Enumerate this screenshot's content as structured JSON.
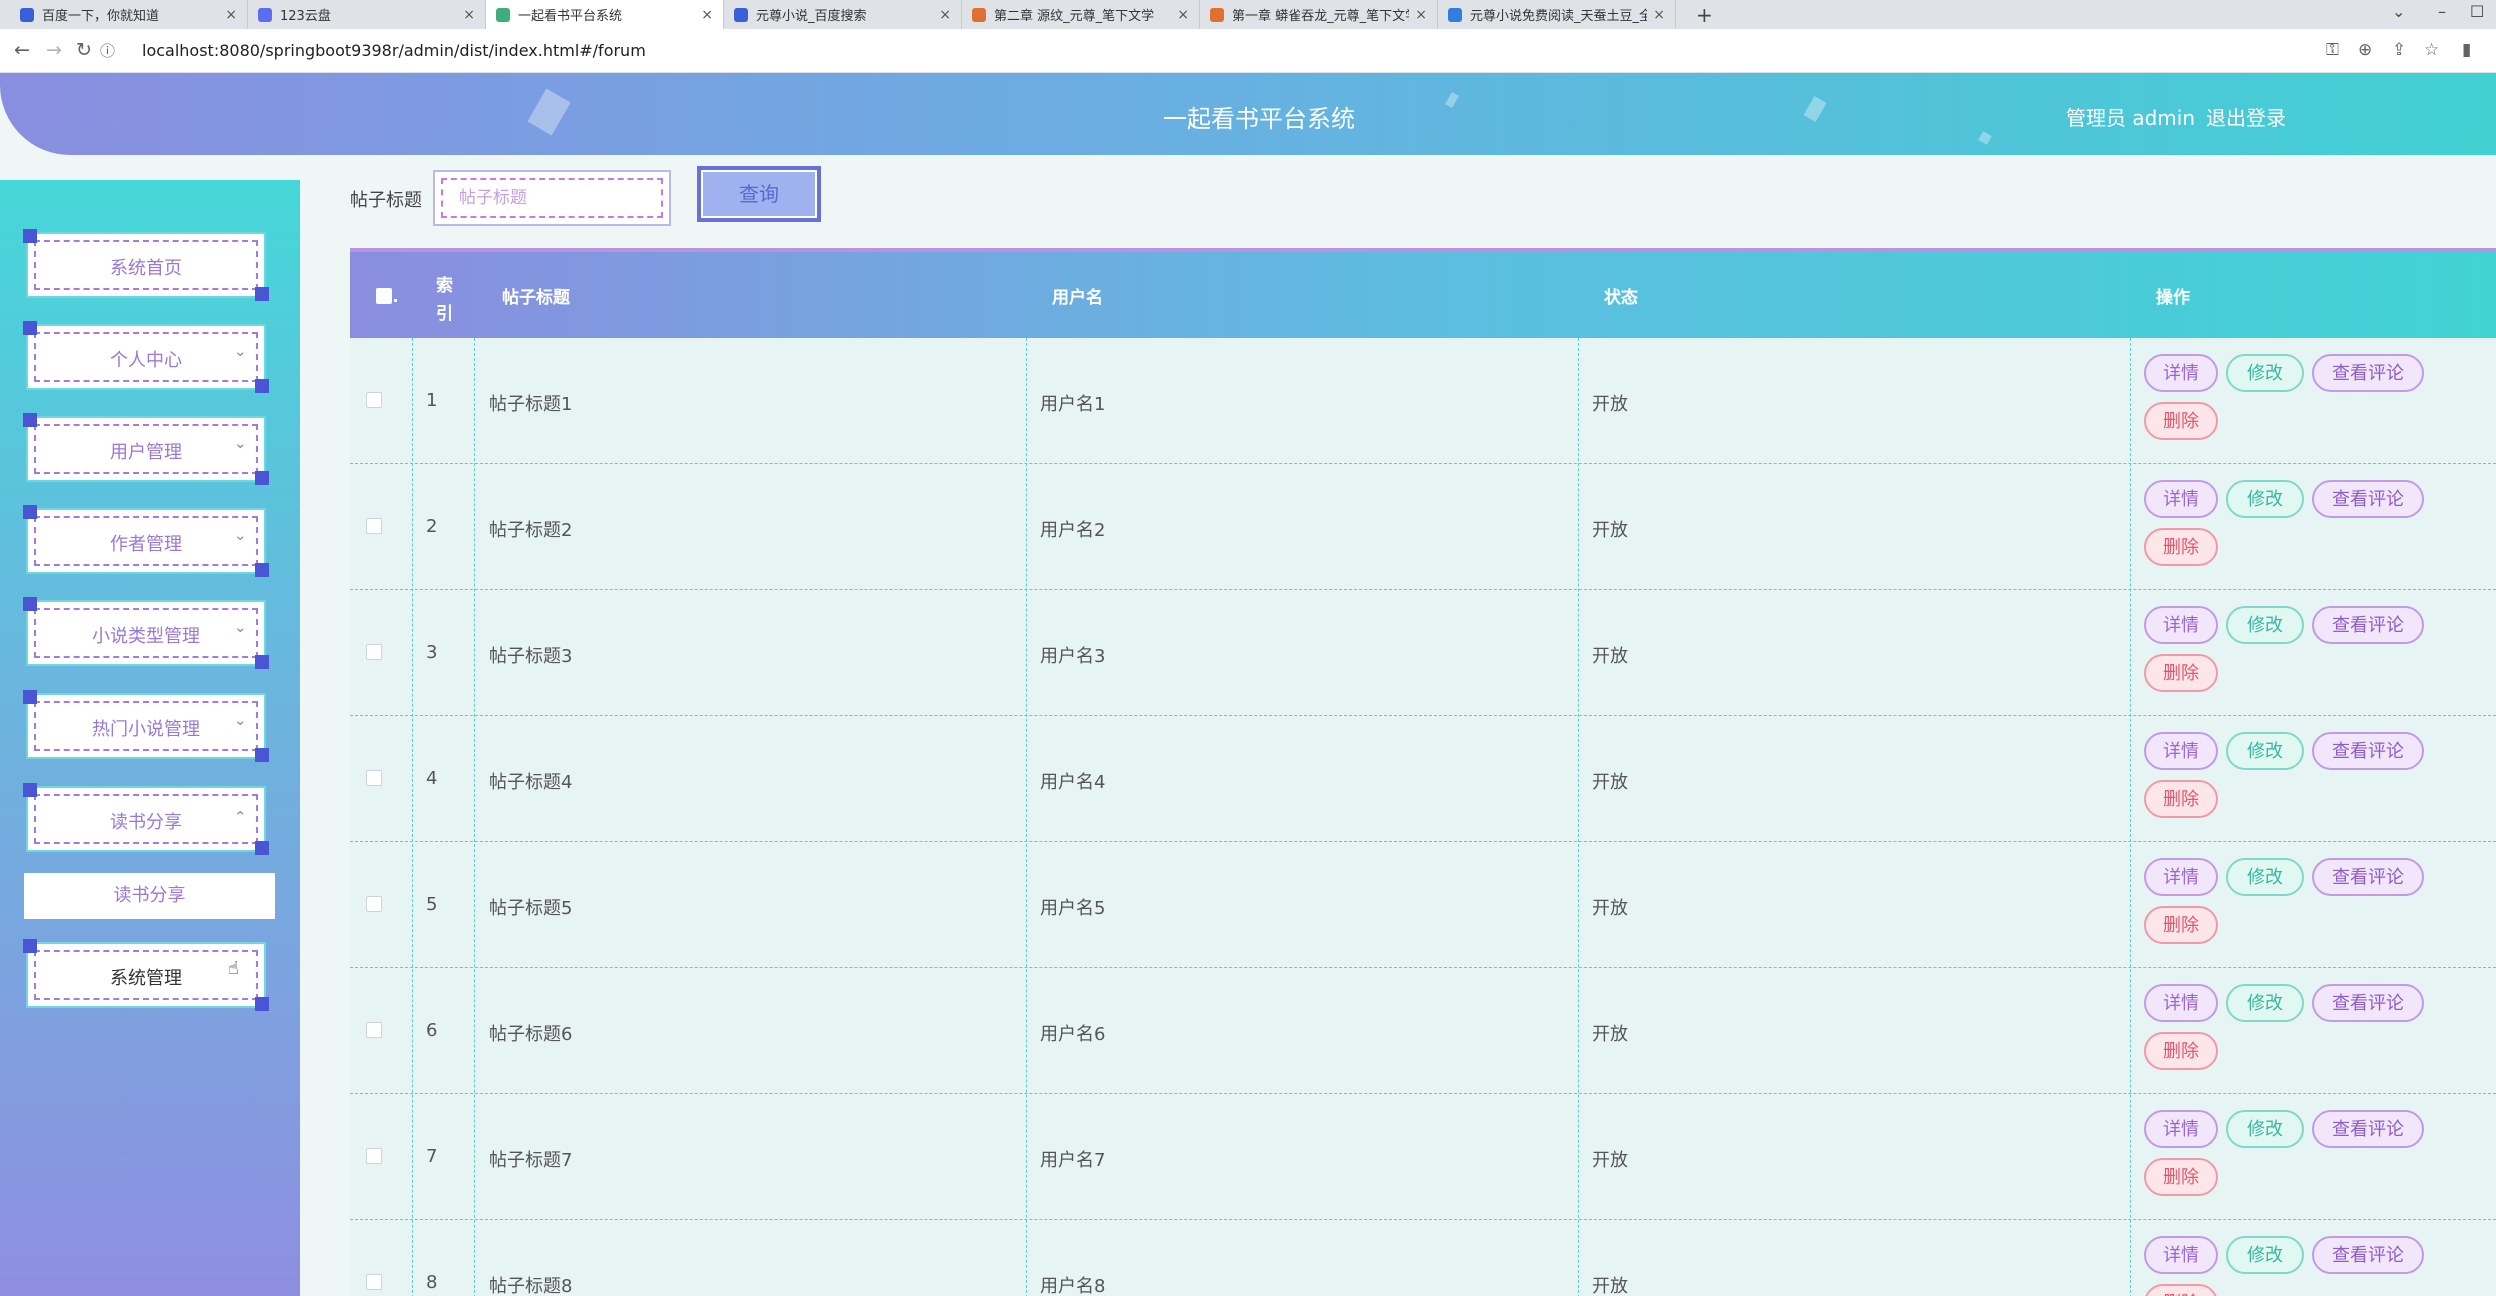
{
  "browser": {
    "tabs": [
      {
        "label": "百度一下，你就知道",
        "active": false,
        "favicon": "baidu-icon",
        "color": "#3a5fd9"
      },
      {
        "label": "123云盘",
        "active": false,
        "favicon": "cloud-icon",
        "color": "#5b6ef0"
      },
      {
        "label": "一起看书平台系统",
        "active": true,
        "favicon": "vue-icon",
        "color": "#3eaf7c"
      },
      {
        "label": "元尊小说_百度搜索",
        "active": false,
        "favicon": "baidu-icon",
        "color": "#3a5fd9"
      },
      {
        "label": "第二章 源纹_元尊_笔下文学",
        "active": false,
        "favicon": "book-icon",
        "color": "#e0702f"
      },
      {
        "label": "第一章 蟒雀吞龙_元尊_笔下文学",
        "active": false,
        "favicon": "book-icon",
        "color": "#e0702f"
      },
      {
        "label": "元尊小说免费阅读_天蚕土豆_全",
        "active": false,
        "favicon": "book-icon",
        "color": "#2f7fe0"
      }
    ],
    "url": "localhost:8080/springboot9398r/admin/dist/index.html#/forum"
  },
  "header": {
    "title": "一起看书平台系统",
    "admin": "管理员 admin",
    "logout": "退出登录"
  },
  "sidebar": {
    "items": [
      {
        "label": "系统首页",
        "has_chevron": false
      },
      {
        "label": "个人中心",
        "has_chevron": true,
        "chevron": "⌄"
      },
      {
        "label": "用户管理",
        "has_chevron": true,
        "chevron": "⌄"
      },
      {
        "label": "作者管理",
        "has_chevron": true,
        "chevron": "⌄"
      },
      {
        "label": "小说类型管理",
        "has_chevron": true,
        "chevron": "⌄"
      },
      {
        "label": "热门小说管理",
        "has_chevron": true,
        "chevron": "⌄"
      },
      {
        "label": "读书分享",
        "has_chevron": true,
        "chevron": "⌃"
      }
    ],
    "submenu": "读书分享",
    "last_item": "系统管理"
  },
  "search": {
    "label": "帖子标题",
    "placeholder": "帖子标题",
    "button": "查询"
  },
  "table": {
    "headers": {
      "index": "索引",
      "title": "帖子标题",
      "username": "用户名",
      "status": "状态",
      "actions": "操作"
    },
    "actions": {
      "detail": "详情",
      "edit": "修改",
      "comments": "查看评论",
      "delete": "删除"
    },
    "rows": [
      {
        "index": "1",
        "title": "帖子标题1",
        "username": "用户名1",
        "status": "开放"
      },
      {
        "index": "2",
        "title": "帖子标题2",
        "username": "用户名2",
        "status": "开放"
      },
      {
        "index": "3",
        "title": "帖子标题3",
        "username": "用户名3",
        "status": "开放"
      },
      {
        "index": "4",
        "title": "帖子标题4",
        "username": "用户名4",
        "status": "开放"
      },
      {
        "index": "5",
        "title": "帖子标题5",
        "username": "用户名5",
        "status": "开放"
      },
      {
        "index": "6",
        "title": "帖子标题6",
        "username": "用户名6",
        "status": "开放"
      },
      {
        "index": "7",
        "title": "帖子标题7",
        "username": "用户名7",
        "status": "开放"
      },
      {
        "index": "8",
        "title": "帖子标题8",
        "username": "用户名8",
        "status": "开放"
      }
    ]
  }
}
